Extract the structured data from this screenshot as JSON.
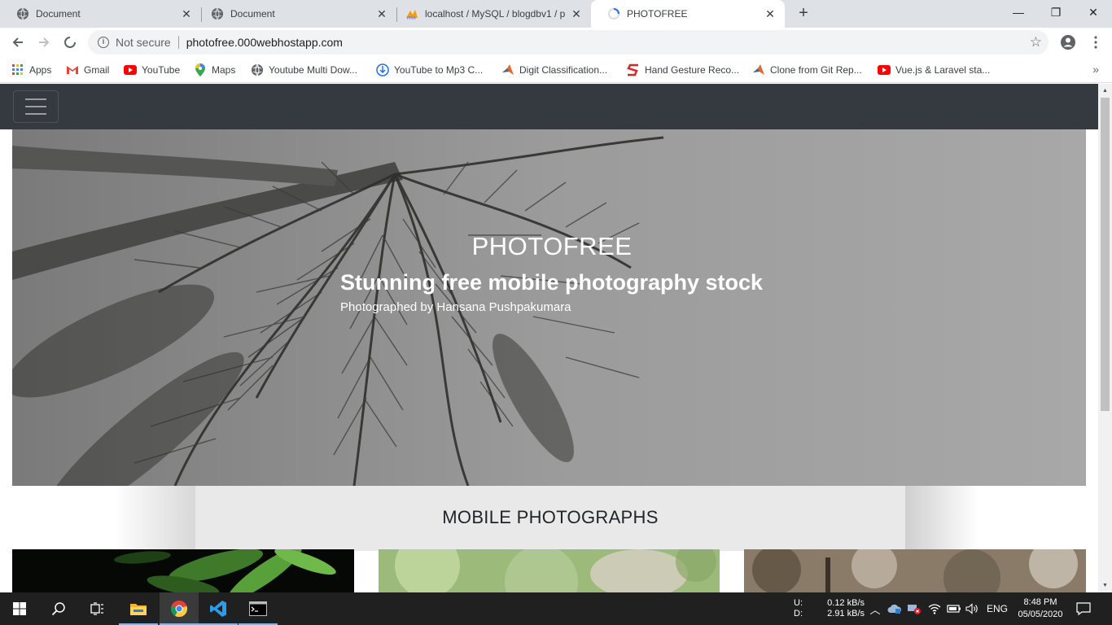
{
  "tabs": [
    {
      "title": "Document",
      "active": false
    },
    {
      "title": "Document",
      "active": false
    },
    {
      "title": "localhost / MySQL / blogdbv1 / p",
      "active": false
    },
    {
      "title": "PHOTOFREE",
      "active": true
    }
  ],
  "window_controls": {
    "minimize": "—",
    "maximize": "❐",
    "close": "✕"
  },
  "omnibox": {
    "security": "Not secure",
    "url": "photofree.000webhostapp.com"
  },
  "bookmarks": [
    {
      "label": "Apps",
      "icon": "apps-grid-icon"
    },
    {
      "label": "Gmail",
      "icon": "gmail-icon"
    },
    {
      "label": "YouTube",
      "icon": "youtube-icon"
    },
    {
      "label": "Maps",
      "icon": "maps-icon"
    },
    {
      "label": "Youtube Multi Dow...",
      "icon": "globe-icon"
    },
    {
      "label": "YouTube to Mp3 C...",
      "icon": "download-icon"
    },
    {
      "label": "Digit Classification...",
      "icon": "matlab-icon"
    },
    {
      "label": "Hand Gesture Reco...",
      "icon": "s-logo-icon"
    },
    {
      "label": "Clone from Git Rep...",
      "icon": "matlab-icon"
    },
    {
      "label": "Vue.js & Laravel sta...",
      "icon": "youtube-icon"
    }
  ],
  "page": {
    "hero": {
      "title": "PHOTOFREE",
      "subtitle": "Stunning free mobile photography stock",
      "credit": "Photographed by Hansana Pushpakumara"
    },
    "section_title": "MOBILE PHOTOGRAPHS"
  },
  "taskbar": {
    "apps": [
      "start-icon",
      "search-icon",
      "task-view-icon",
      "file-explorer-icon",
      "chrome-icon",
      "vscode-icon",
      "terminal-icon"
    ],
    "net_up_label": "U:",
    "net_down_label": "D:",
    "net_up": "0.12 kB/s",
    "net_down": "2.91 kB/s",
    "language": "ENG",
    "time": "8:48 PM",
    "date": "05/05/2020"
  },
  "colors": {
    "navbar": "#343a40",
    "tab_strip": "#dee1e6",
    "taskbar": "#202020"
  }
}
